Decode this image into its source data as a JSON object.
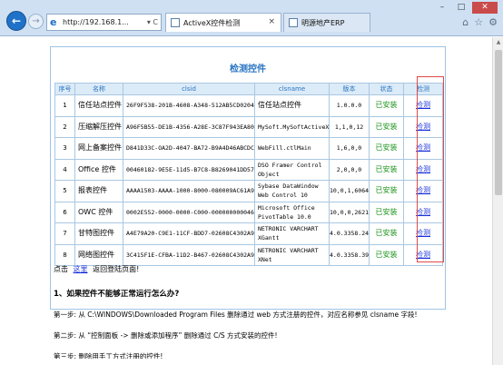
{
  "browser": {
    "url": "http://192.168.1...",
    "tabs": [
      {
        "label": "ActiveX控件检测",
        "close": "×"
      },
      {
        "label": "明源地产ERP"
      }
    ]
  },
  "page": {
    "title": "检测控件",
    "table": {
      "headers": [
        "序号",
        "名称",
        "clsid",
        "clsname",
        "版本",
        "状态",
        "检测"
      ],
      "rows": [
        {
          "no": "1",
          "name": "信任站点控件",
          "clsid": "26F9F538-201B-4608-A348-512AB5CD0204",
          "clsname": "信任站点控件",
          "version": "1.0.0.0",
          "status": "已安装",
          "check": "检测"
        },
        {
          "no": "2",
          "name": "压缩解压控件",
          "clsid": "A96F5B55-DE1B-4356-A28E-3C87F943EA80",
          "clsname": "MySoft.MySoftActiveX",
          "version": "1,1,0,12",
          "status": "已安装",
          "check": "检测"
        },
        {
          "no": "3",
          "name": "网上备案控件",
          "clsid": "D841D33C-OA2D-4047-BA72-B9A4D46ABCDC",
          "clsname": "WebFill.ctlMain",
          "version": "1,6,0,0",
          "status": "已安装",
          "check": "检测"
        },
        {
          "no": "4",
          "name": "Office 控件",
          "clsid": "00460182-9E5E-11d5-B7C8-B8269041DD57",
          "clsname": "DSO Framer Control Object",
          "version": "2,0,0,0",
          "status": "已安装",
          "check": "检测"
        },
        {
          "no": "5",
          "name": "报表控件",
          "clsid": "AAAA1503-AAAA-1000-8000-080009AC61A9",
          "clsname": "Sybase DataWindow Web Control 10",
          "version": "10,0,1,6064",
          "status": "已安装",
          "check": "检测"
        },
        {
          "no": "6",
          "name": "OWC 控件",
          "clsid": "0002E552-0000-0000-C000-000000000046",
          "clsname": "Microsoft Office PivotTable 10.0",
          "version": "10,0,0,2621",
          "status": "已安装",
          "check": "检测"
        },
        {
          "no": "7",
          "name": "甘特图控件",
          "clsid": "A4E79A20-C9E1-11CF-BDD7-02608C4302A9",
          "clsname": "NETRONIC VARCHART XGantt",
          "version": "4.0.3358.24",
          "status": "已安装",
          "check": "检测"
        },
        {
          "no": "8",
          "name": "网络图控件",
          "clsid": "3C415F1E-CFBA-11D2-B467-02608C4302A9",
          "clsname": "NETRONIC VARCHART XNet",
          "version": "4.0.3358.39",
          "status": "已安装",
          "check": "检测"
        }
      ]
    },
    "back_prefix": "点击",
    "back_link": "这里",
    "back_suffix": "返回登陆页面!",
    "faq_title": "1、如果控件不能够正常运行怎么办?",
    "step1": "第一步: 从 C:\\WINDOWS\\Downloaded Program Files 删除通过 web 方式注册的控件，对应名称参见 clsname 字段!",
    "step2": "第二步: 从 “控制面板 -> 删除或添加程序” 删除通过 C/S 方式安装的控件!",
    "step3": "第三步: 删除用手工方式注册的控件!"
  }
}
